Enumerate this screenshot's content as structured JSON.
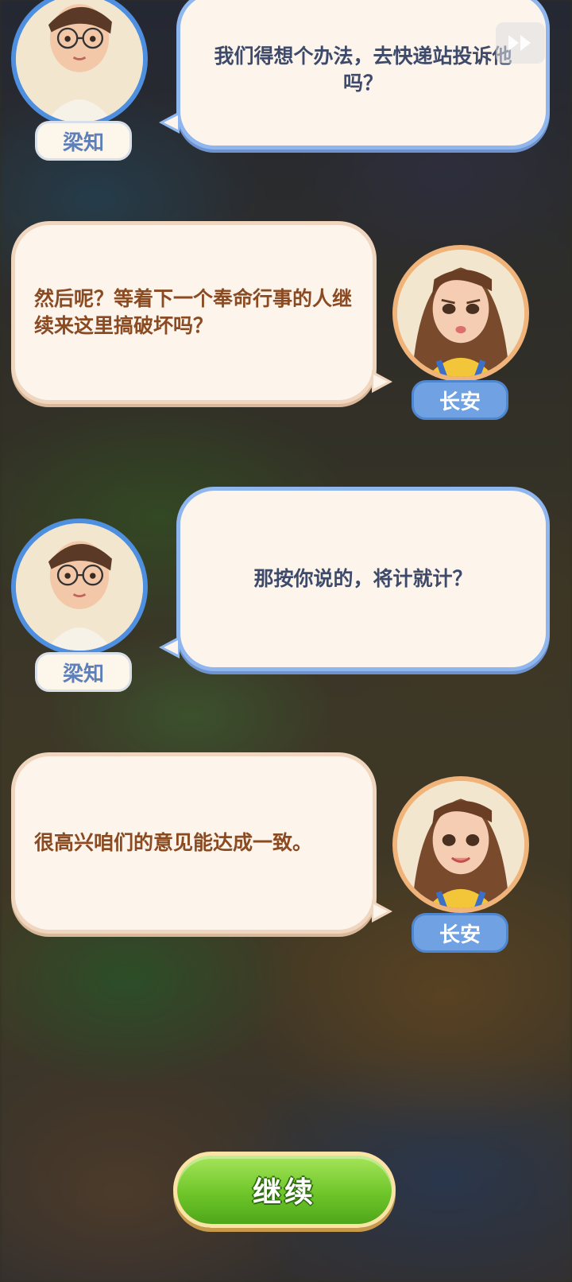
{
  "dialogue": [
    {
      "speaker": "梁知",
      "text": "我们得想个办法，去快递站投诉他吗？"
    },
    {
      "speaker": "长安",
      "text": "然后呢？等着下一个奉命行事的人继续来这里搞破坏吗？"
    },
    {
      "speaker": "梁知",
      "text": "那按你说的，将计就计？"
    },
    {
      "speaker": "长安",
      "text": "很高兴咱们的意见能达成一致。"
    }
  ],
  "continue_label": "继续",
  "icons": {
    "corner": "fast-forward-icon"
  },
  "colors": {
    "male_accent": "#4f8fe0",
    "female_accent": "#f0b47a",
    "continue_green": "#6fc62a"
  }
}
